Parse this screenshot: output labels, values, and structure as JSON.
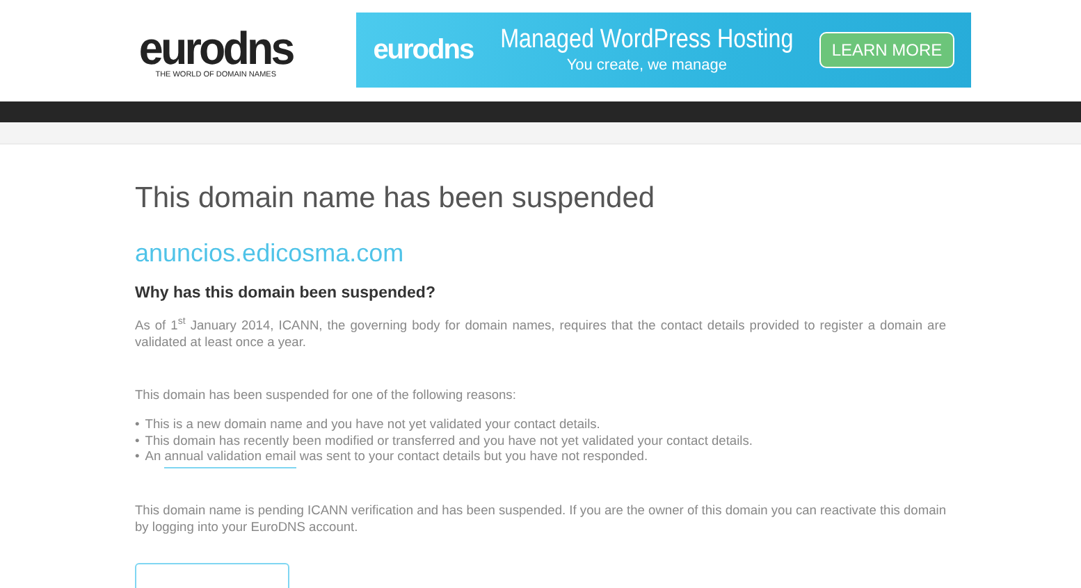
{
  "header": {
    "logo": "eurodns",
    "tagline": "THE WORLD OF DOMAIN NAMES"
  },
  "banner": {
    "logo": "eurodns",
    "title": "Managed WordPress Hosting",
    "subtitle": "You create, we manage",
    "button": "LEARN MORE"
  },
  "title": "This domain name has been suspended",
  "domain": "anuncios.edicosma.com",
  "heading": "Why has this domain been suspended?",
  "intro": "As of 1$^{st}$ January 2014, ICANN, the governing body for domain names, requires that the contact details provided to register a domain are validated at least once a year.",
  "reasons_intro": "This domain has been suspended for one of the following reasons:",
  "reasons": [
    {
      "bullet": "•",
      "before": "This is a new domain name and you have not yet validated your contact details."
    },
    {
      "bullet": "•",
      "before": "This domain has recently been modified or transferred and you have not yet validated your contact details."
    },
    {
      "bullet": "•",
      "before": "An ",
      "link": "annual validation email",
      "after": " was sent to your contact details but you have not responded."
    }
  ],
  "note": "This domain name is pending ICANN verification and has been suspended. If you are the owner of this domain you can reactivate this domain by logging into your EuroDNS account."
}
